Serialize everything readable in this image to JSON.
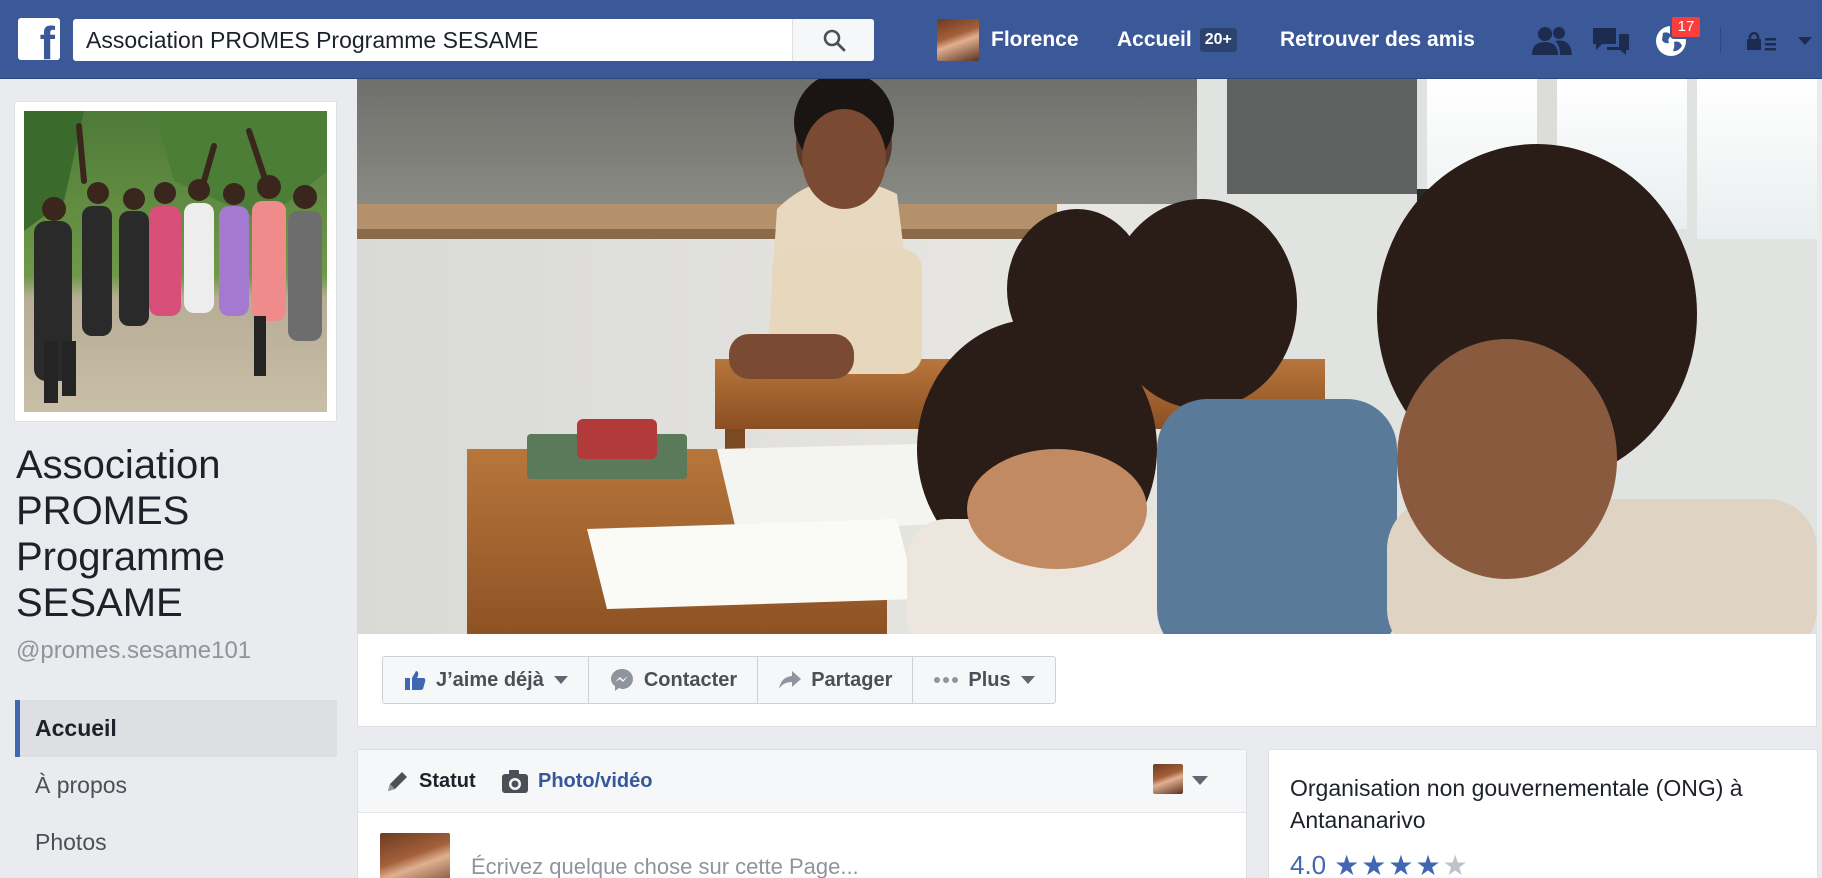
{
  "topbar": {
    "search_value": "Association PROMES Programme SESAME",
    "profile_name": "Florence",
    "home_label": "Accueil",
    "home_badge": "20+",
    "find_friends_label": "Retrouver des amis",
    "notifications_count": "17",
    "icons": [
      "facebook-logo",
      "search-icon",
      "friend-requests-icon",
      "messages-icon",
      "notifications-globe-icon",
      "privacy-lock-icon",
      "account-menu-caret-icon"
    ]
  },
  "page": {
    "name": "Association PROMES Programme SESAME",
    "handle": "@promes.sesame101"
  },
  "sidebar": {
    "items": [
      {
        "label": "Accueil",
        "active": true
      },
      {
        "label": "À propos",
        "active": false
      },
      {
        "label": "Photos",
        "active": false
      }
    ]
  },
  "actions": {
    "like_label": "J’aime déjà",
    "contact_label": "Contacter",
    "share_label": "Partager",
    "more_label": "Plus"
  },
  "composer": {
    "status_label": "Statut",
    "photo_label": "Photo/vidéo",
    "placeholder": "Écrivez quelque chose sur cette Page..."
  },
  "about": {
    "category": "Organisation non gouvernementale (ONG) à Antananarivo",
    "rating": "4.0",
    "rating_stars": 4,
    "rating_max": 5
  },
  "colors": {
    "brand_blue": "#3b5998",
    "link_blue": "#4267b2",
    "notification_red": "#fa3e3e",
    "background": "#e9ebee"
  }
}
